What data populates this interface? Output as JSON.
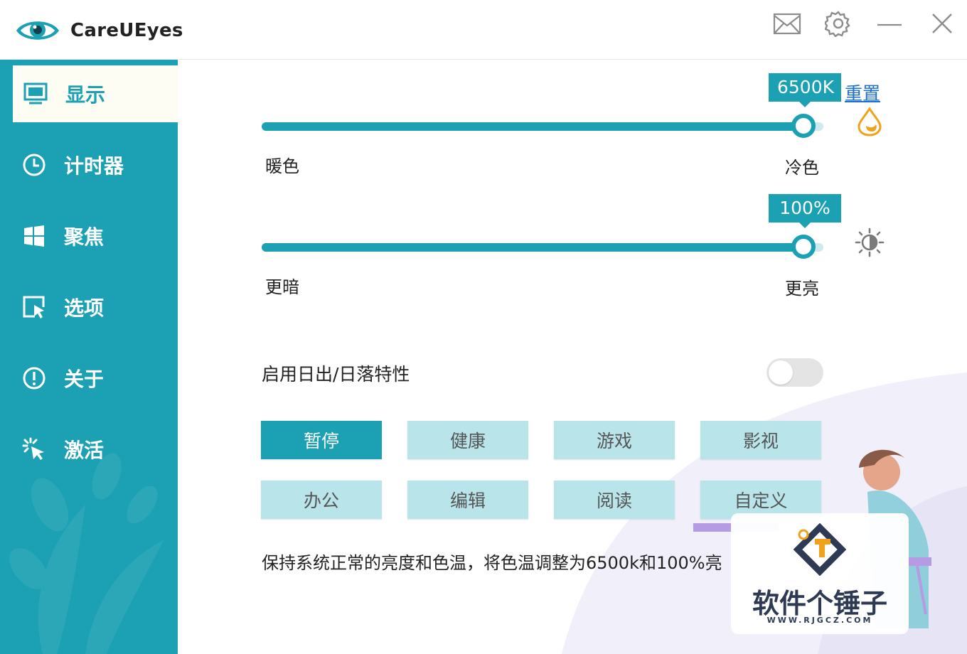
{
  "app": {
    "name": "CareUEyes"
  },
  "titlebar": {
    "icons": [
      "mail-icon",
      "gear-icon",
      "minimize-icon",
      "close-icon"
    ]
  },
  "sidebar": {
    "items": [
      {
        "label": "显示",
        "icon": "monitor-icon",
        "active": true
      },
      {
        "label": "计时器",
        "icon": "clock-icon",
        "active": false
      },
      {
        "label": "聚焦",
        "icon": "windows-icon",
        "active": false
      },
      {
        "label": "选项",
        "icon": "cursor-window-icon",
        "active": false
      },
      {
        "label": "关于",
        "icon": "info-circle-icon",
        "active": false
      },
      {
        "label": "激活",
        "icon": "sparkle-cursor-icon",
        "active": false
      }
    ]
  },
  "display": {
    "color_temp": {
      "value_label": "6500K",
      "level": 0.965,
      "left_label": "暖色",
      "right_label": "冷色",
      "reset_label": "重置",
      "icon": "drop-icon"
    },
    "brightness": {
      "value_label": "100%",
      "level": 0.965,
      "left_label": "更暗",
      "right_label": "更亮",
      "icon": "brightness-icon"
    },
    "sunrise_sunset": {
      "label": "启用日出/日落特性",
      "enabled": false
    },
    "modes": [
      {
        "label": "暂停",
        "active": true
      },
      {
        "label": "健康",
        "active": false
      },
      {
        "label": "游戏",
        "active": false
      },
      {
        "label": "影视",
        "active": false
      },
      {
        "label": "办公",
        "active": false
      },
      {
        "label": "编辑",
        "active": false
      },
      {
        "label": "阅读",
        "active": false
      },
      {
        "label": "自定义",
        "active": false
      }
    ],
    "description": "保持系统正常的亮度和色温，将色温调整为6500k和100%亮"
  },
  "watermark": {
    "title": "软件个锤子",
    "url": "WWW.RJGCZ.COM"
  },
  "colors": {
    "accent": "#1ba1b3",
    "mode_inactive": "#b9e4ea",
    "active_nav_bg": "#fdfdf3",
    "link": "#1a6fd0",
    "drop_icon": "#f0a21c"
  }
}
